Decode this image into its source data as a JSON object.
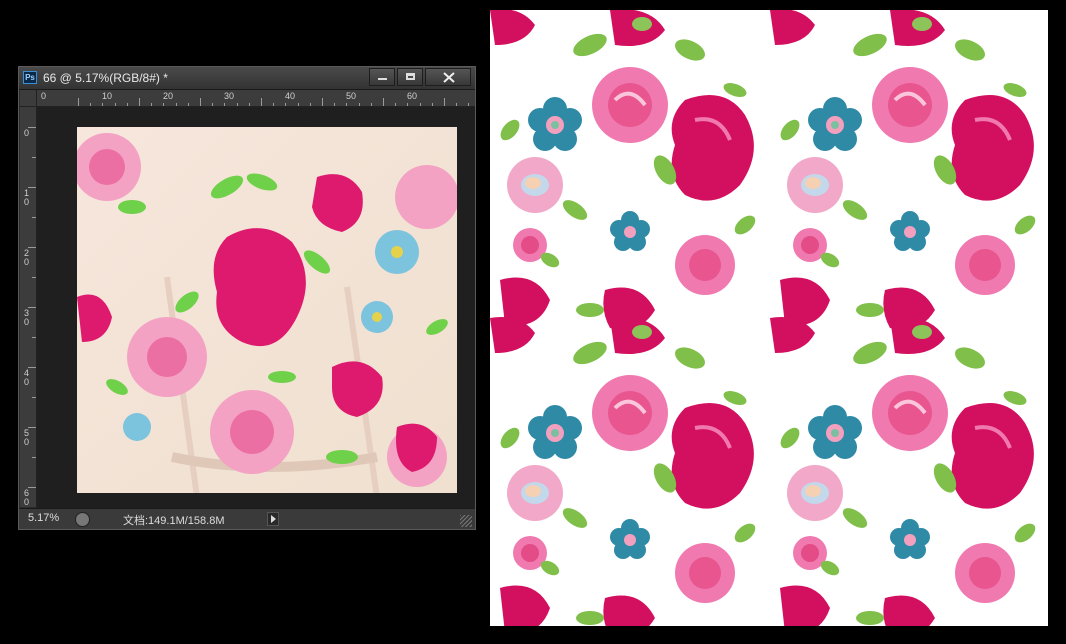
{
  "window": {
    "app_icon_text": "Ps",
    "title": "66 @ 5.17%(RGB/8#) *"
  },
  "ruler": {
    "h_labels": [
      "0",
      "10",
      "20",
      "30",
      "40",
      "50",
      "60"
    ],
    "v_labels": [
      "0",
      "10",
      "20",
      "30",
      "40",
      "50",
      "60"
    ]
  },
  "status": {
    "zoom": "5.17%",
    "doc_info": "文档:149.1M/158.8M"
  },
  "colors": {
    "rose_dark": "#d3105f",
    "rose_light": "#f07ab0",
    "teal": "#2f8aa6",
    "leaf": "#7fbf4a",
    "fabric": "#f5e8da"
  }
}
